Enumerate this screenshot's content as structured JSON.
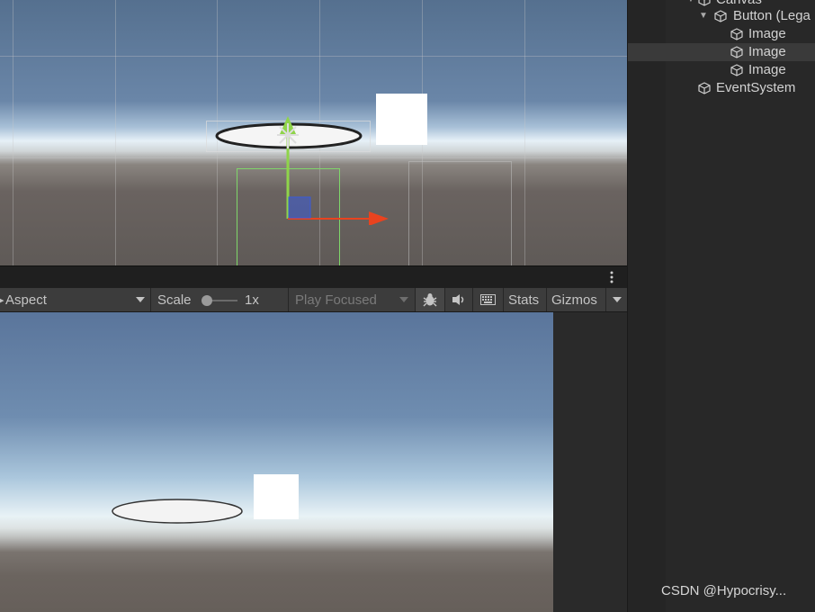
{
  "toolbar": {
    "aspect_label": "Aspect",
    "scale_label": "Scale",
    "scale_value": "1x",
    "play_mode_label": "Play Focused",
    "stats_label": "Stats",
    "gizmos_label": "Gizmos"
  },
  "hierarchy": {
    "items": [
      {
        "label": "Canvas",
        "depth": 0,
        "expanded": true
      },
      {
        "label": "Button (Lega",
        "depth": 1,
        "expanded": true
      },
      {
        "label": "Image",
        "depth": 2
      },
      {
        "label": "Image",
        "depth": 2,
        "selected": true
      },
      {
        "label": "Image",
        "depth": 2
      },
      {
        "label": "EventSystem",
        "depth": 0
      }
    ]
  },
  "watermark": "CSDN @Hypocrisy...",
  "colors": {
    "gizmo_x": "#e9431f",
    "gizmo_y": "#8fd44a",
    "gizmo_z": "#3b5bd6",
    "selection_outline": "#7fd66a"
  }
}
